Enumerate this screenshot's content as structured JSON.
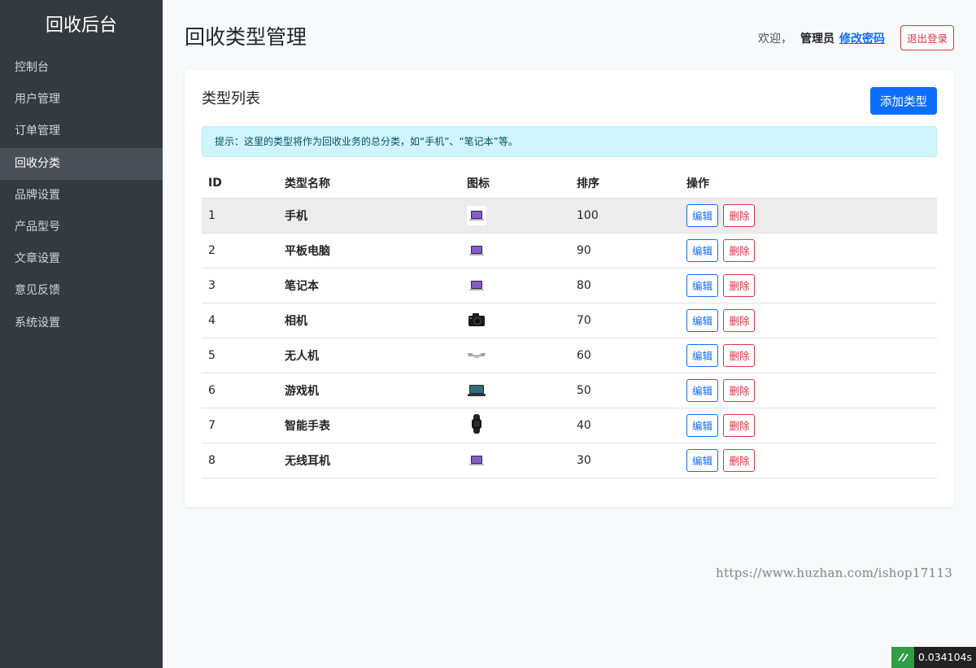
{
  "sidebar": {
    "brand": "回收后台",
    "items": [
      {
        "label": "控制台"
      },
      {
        "label": "用户管理"
      },
      {
        "label": "订单管理"
      },
      {
        "label": "回收分类",
        "active": true
      },
      {
        "label": "品牌设置"
      },
      {
        "label": "产品型号"
      },
      {
        "label": "文章设置"
      },
      {
        "label": "意见反馈"
      },
      {
        "label": "系统设置"
      }
    ]
  },
  "header": {
    "title": "回收类型管理",
    "welcome": "欢迎，",
    "username": "管理员",
    "change_password": "修改密码",
    "logout": "退出登录"
  },
  "card": {
    "title": "类型列表",
    "add_button": "添加类型",
    "tip": "提示：这里的类型将作为回收业务的总分类，如“手机”、“笔记本”等。"
  },
  "table": {
    "headers": {
      "id": "ID",
      "name": "类型名称",
      "icon": "图标",
      "sort": "排序",
      "ops": "操作"
    },
    "edit_label": "编辑",
    "delete_label": "删除",
    "rows": [
      {
        "id": "1",
        "name": "手机",
        "icon": "laptop-icon",
        "sort": "100"
      },
      {
        "id": "2",
        "name": "平板电脑",
        "icon": "laptop-icon",
        "sort": "90"
      },
      {
        "id": "3",
        "name": "笔记本",
        "icon": "laptop-icon",
        "sort": "80"
      },
      {
        "id": "4",
        "name": "相机",
        "icon": "camera-icon",
        "sort": "70"
      },
      {
        "id": "5",
        "name": "无人机",
        "icon": "drone-icon",
        "sort": "60"
      },
      {
        "id": "6",
        "name": "游戏机",
        "icon": "game-console-icon",
        "sort": "50"
      },
      {
        "id": "7",
        "name": "智能手表",
        "icon": "smartwatch-icon",
        "sort": "40"
      },
      {
        "id": "8",
        "name": "无线耳机",
        "icon": "laptop-icon",
        "sort": "30"
      }
    ]
  },
  "watermark": "https://www.huzhan.com/ishop17113",
  "timer": "0.034104s",
  "colors": {
    "sidebar_bg": "#343a40",
    "primary": "#0d6efd",
    "danger": "#dc3545",
    "info_bg": "#cff4fc"
  }
}
